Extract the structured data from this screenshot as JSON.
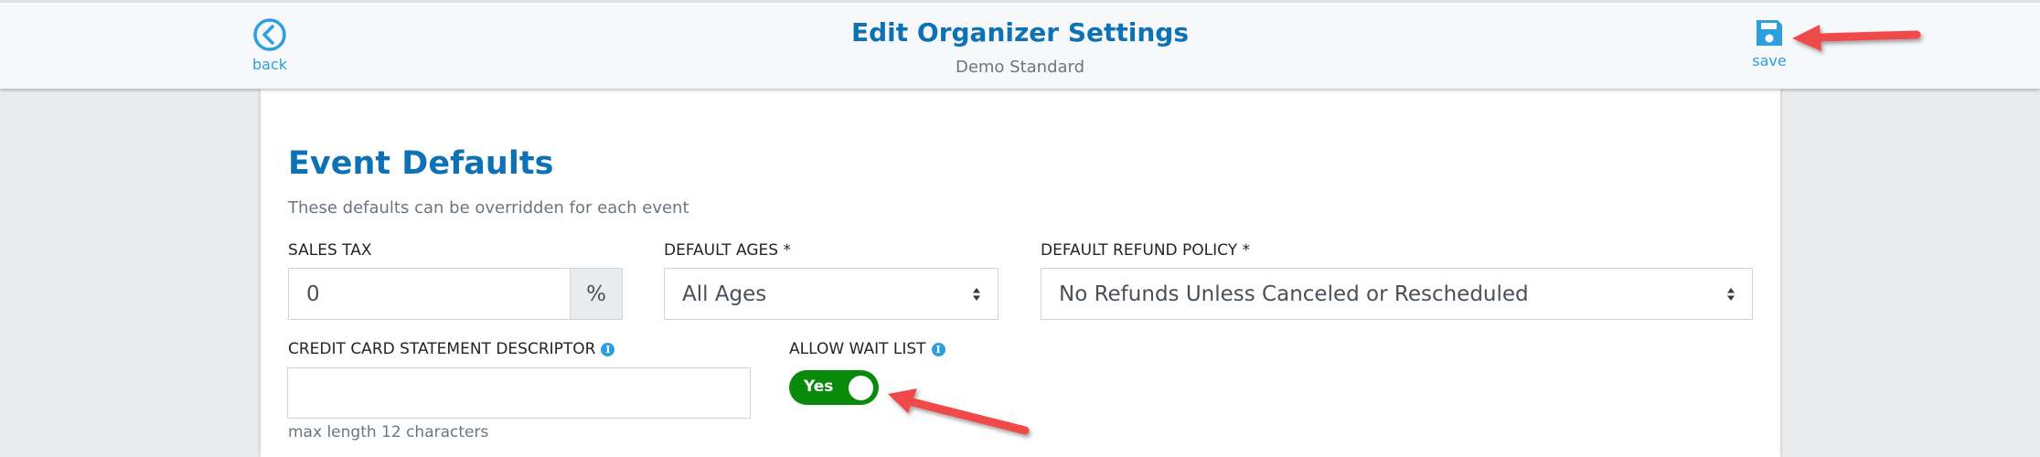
{
  "header": {
    "title": "Edit Organizer Settings",
    "subtitle": "Demo Standard",
    "back_label": "back",
    "save_label": "save",
    "back_icon": "chevron-left-circle-icon",
    "save_icon": "floppy-disk-icon"
  },
  "section": {
    "title": "Event Defaults",
    "description": "These defaults can be overridden for each event"
  },
  "fields": {
    "sales_tax": {
      "label": "SALES TAX",
      "value": "0",
      "addon": "%"
    },
    "default_ages": {
      "label": "DEFAULT AGES *",
      "value": "All Ages"
    },
    "default_refund_policy": {
      "label": "DEFAULT REFUND POLICY *",
      "value": "No Refunds Unless Canceled or Rescheduled"
    },
    "credit_card_descriptor": {
      "label": "CREDIT CARD STATEMENT DESCRIPTOR",
      "value": "",
      "help": "max length 12 characters"
    },
    "allow_wait_list": {
      "label": "ALLOW WAIT LIST",
      "toggle_label": "Yes",
      "checked": true
    }
  },
  "colors": {
    "accent": "#0d72b5",
    "link": "#2d9ee0",
    "toggle_on": "#0a8a0a",
    "annotation_arrow": "#f04848"
  }
}
